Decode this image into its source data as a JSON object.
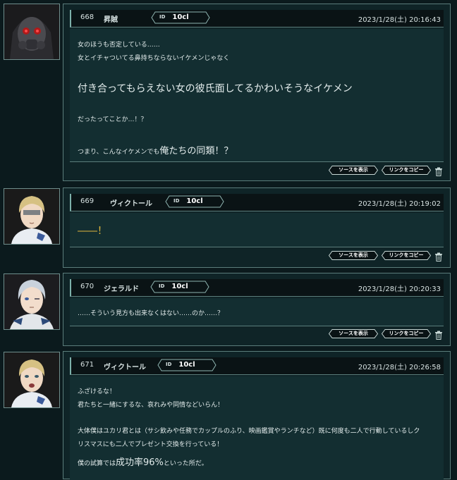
{
  "buttons": {
    "source": "ソースを表示",
    "copy_link": "リンクをコピー"
  },
  "posts": [
    {
      "number": "668",
      "name": "昇賊",
      "id_label": "ID",
      "id_value": "10cl",
      "date": "2023/1/28(土) 20:16:43",
      "lines": [
        "女のほうも否定している……",
        "女とイチャついてる鼻持ちならないイケメンじゃなく",
        "付き合ってもらえない女の彼氏面してるかわいそうなイケメン",
        "だったってことか…！？",
        "つまり、こんなイケメンでも",
        "俺たちの同類！？"
      ]
    },
    {
      "number": "669",
      "name": "ヴィクトール",
      "id_label": "ID",
      "id_value": "10cl",
      "date": "2023/1/28(土) 20:19:02",
      "lines": [
        "――！"
      ]
    },
    {
      "number": "670",
      "name": "ジェラルド",
      "id_label": "ID",
      "id_value": "10cl",
      "date": "2023/1/28(土) 20:20:33",
      "lines": [
        "……そういう見方も出来なくはない……のか……？"
      ]
    },
    {
      "number": "671",
      "name": "ヴィクトール",
      "id_label": "ID",
      "id_value": "10cl",
      "date": "2023/1/28(土) 20:26:58",
      "lines": [
        "ふざけるな！",
        "君たちと一緒にするな、哀れみや同情などいらん！",
        "大体僕はユカリ君とは（サシ飲みや任務でカップルのふり、映画鑑賞やランチなど）既に何度も二人で行動しているしク",
        "リスマスにも二人でプレゼント交換を行っている！",
        "僕の試算では",
        "成功率96%",
        "といった所だ。"
      ]
    }
  ]
}
